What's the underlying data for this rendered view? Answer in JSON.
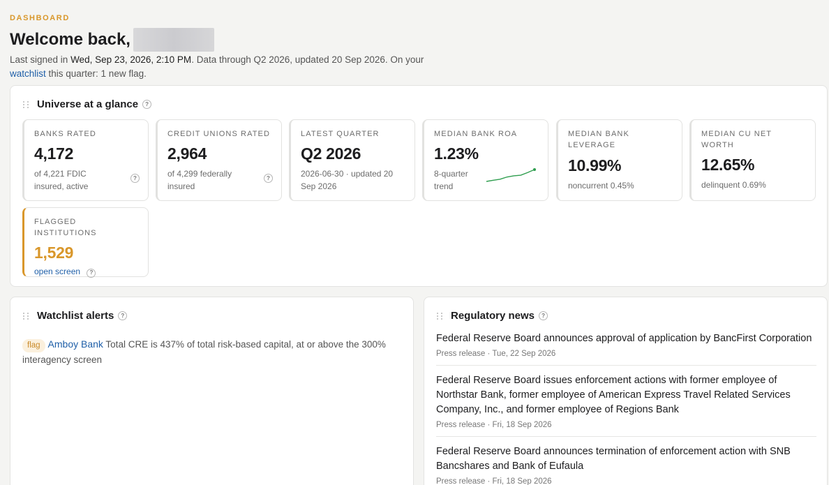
{
  "header": {
    "eyebrow": "DASHBOARD",
    "welcome": "Welcome back,",
    "sub_prefix": "Last signed in ",
    "signed_in": "Wed, Sep 23, 2026, 2:10 PM",
    "sub_middle": ". Data through Q2 2026, updated 20 Sep 2026. On your ",
    "watchlist_link": "watchlist",
    "sub_suffix": " this quarter: 1 new flag."
  },
  "universe": {
    "title": "Universe at a glance",
    "stats": [
      {
        "label": "BANKS RATED",
        "value": "4,172",
        "note": "of 4,221 FDIC insured, active"
      },
      {
        "label": "CREDIT UNIONS RATED",
        "value": "2,964",
        "note": "of 4,299 federally insured"
      },
      {
        "label": "LATEST QUARTER",
        "value": "Q2 2026",
        "note": "2026-06-30 · updated 20 Sep 2026"
      },
      {
        "label": "MEDIAN BANK ROA",
        "value": "1.23%",
        "note": "8-quarter trend"
      },
      {
        "label": "MEDIAN BANK LEVERAGE",
        "value": "10.99%",
        "note": "noncurrent 0.45%"
      },
      {
        "label": "MEDIAN CU NET WORTH",
        "value": "12.65%",
        "note": "delinquent 0.69%"
      },
      {
        "label": "FLAGGED INSTITUTIONS",
        "value": "1,529",
        "note": "open screen"
      }
    ],
    "roa_trend": [
      0.2,
      0.28,
      0.35,
      0.5,
      0.58,
      0.62,
      0.8,
      1.0
    ]
  },
  "watchlist": {
    "title": "Watchlist alerts",
    "alerts": [
      {
        "badge": "flag",
        "institution": "Amboy Bank",
        "text": " Total CRE is 437% of total risk-based capital, at or above the 300% interagency screen"
      }
    ]
  },
  "news": {
    "title": "Regulatory news",
    "items": [
      {
        "title": "Federal Reserve Board announces approval of application by BancFirst Corporation",
        "meta": "Press release · Tue, 22 Sep 2026"
      },
      {
        "title": "Federal Reserve Board issues enforcement actions with former employee of Northstar Bank, former employee of American Express Travel Related Services Company, Inc., and former employee of Regions Bank",
        "meta": "Press release · Fri, 18 Sep 2026"
      },
      {
        "title": "Federal Reserve Board announces termination of enforcement action with SNB Bancshares and Bank of Eufaula",
        "meta": "Press release · Fri, 18 Sep 2026"
      }
    ]
  },
  "colors": {
    "accent": "#d9972b",
    "link": "#1f5fa8",
    "spark": "#2f9e4f"
  }
}
